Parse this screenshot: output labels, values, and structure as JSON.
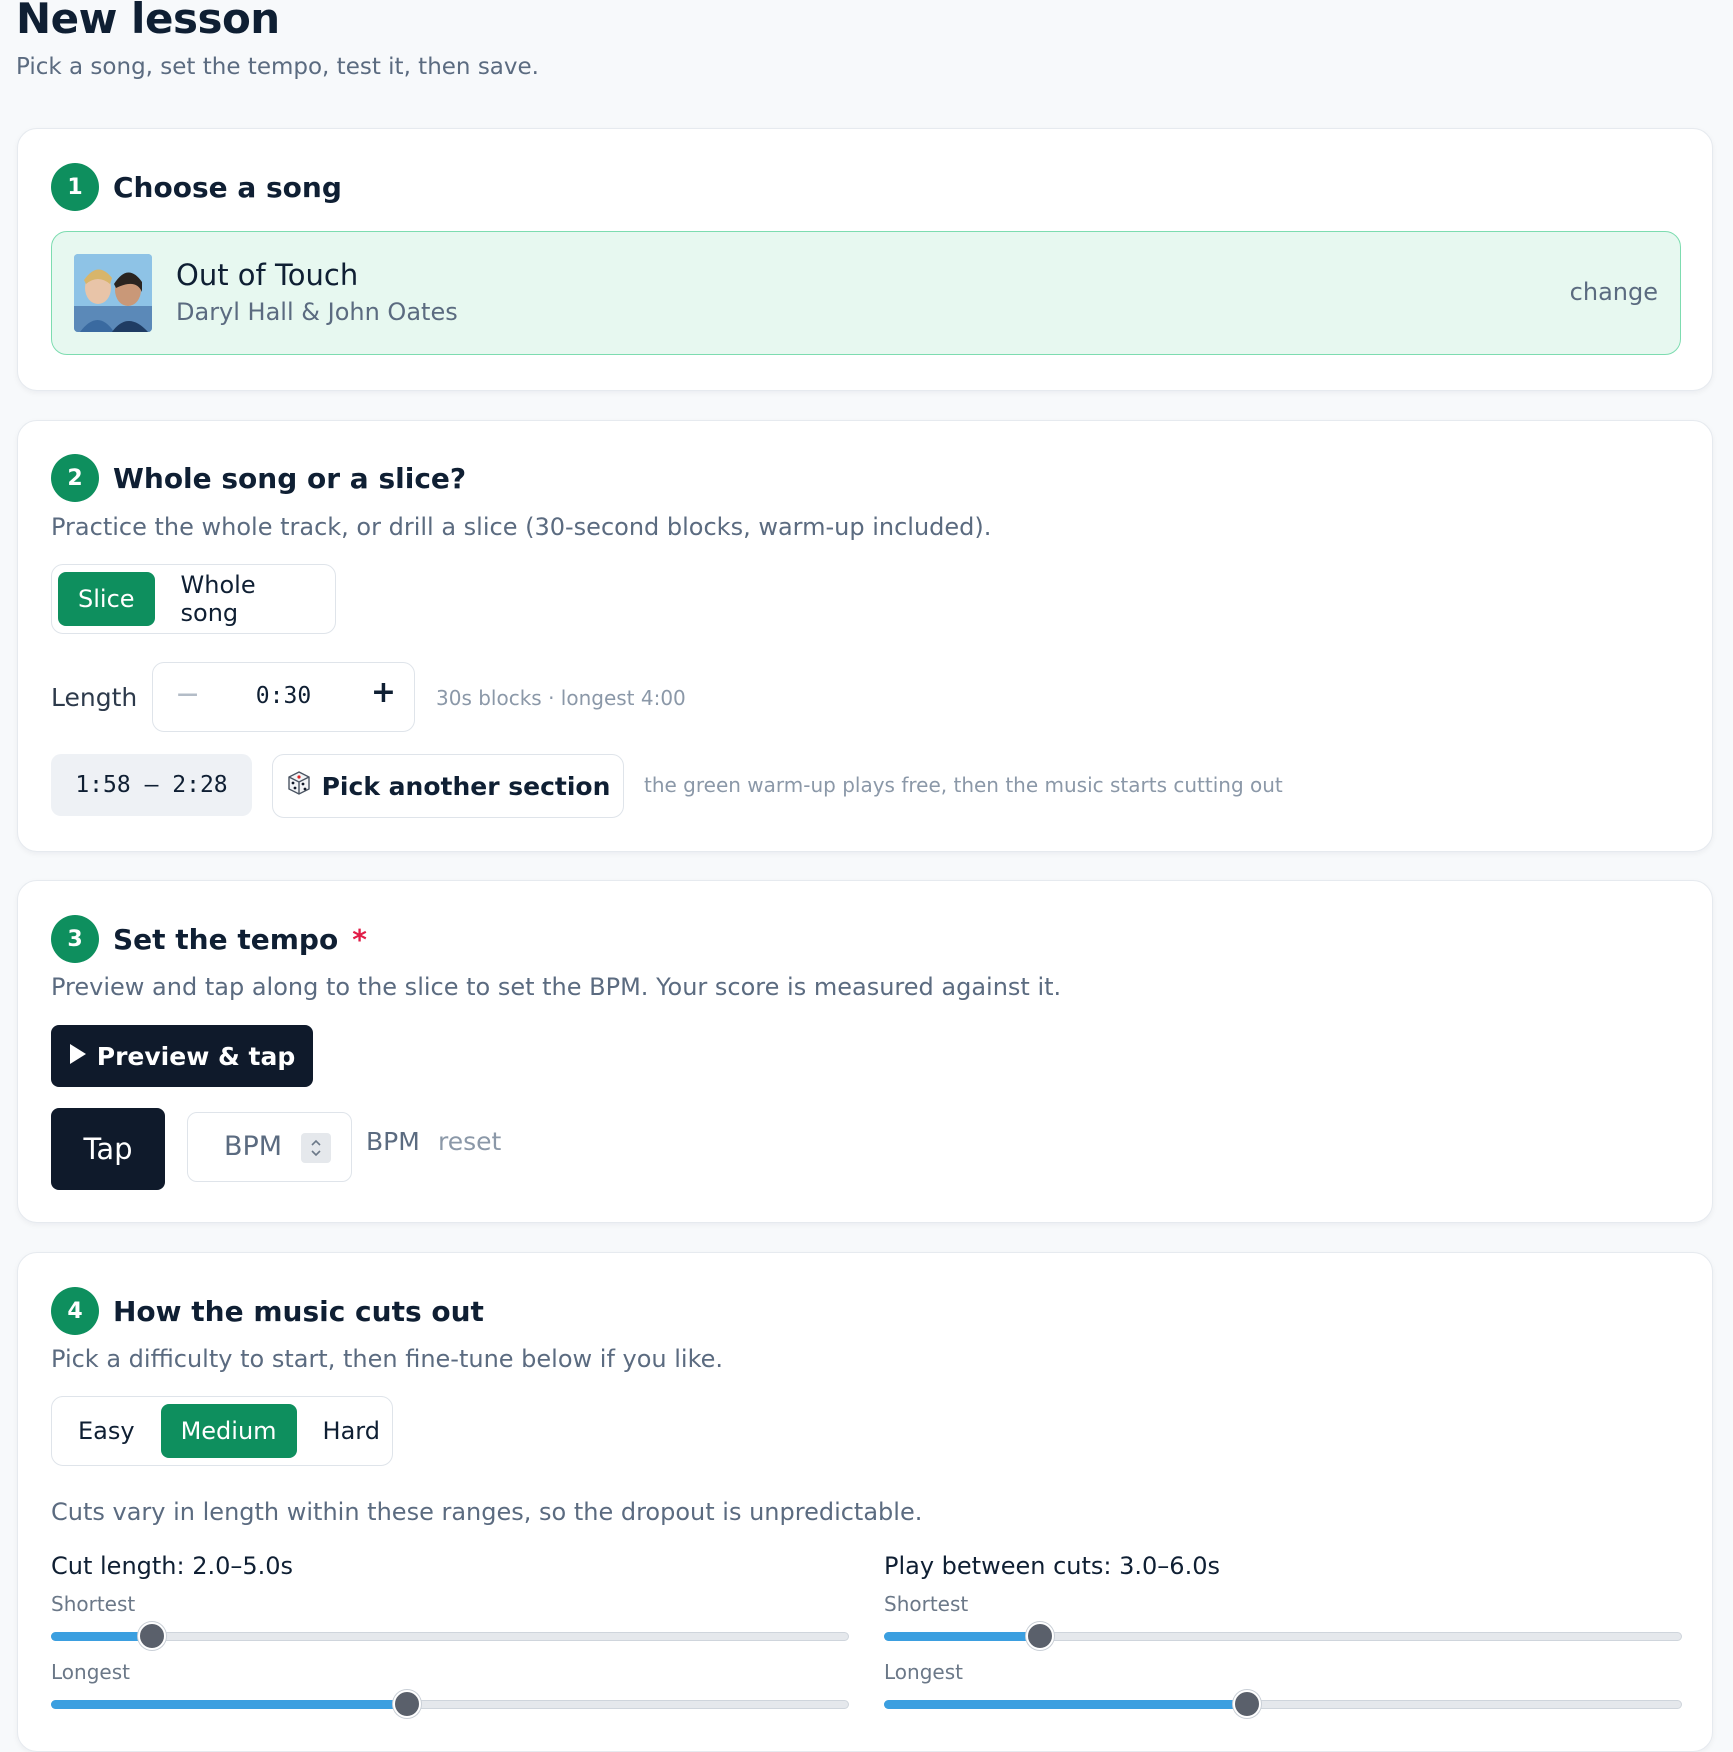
{
  "page": {
    "title": "New lesson",
    "subtitle": "Pick a song, set the tempo, test it, then save."
  },
  "step1": {
    "number": "1",
    "title": "Choose a song",
    "song_title": "Out of Touch",
    "artist": "Daryl Hall & John Oates",
    "change_label": "change"
  },
  "step2": {
    "number": "2",
    "title": "Whole song or a slice?",
    "description": "Practice the whole track, or drill a slice (30-second blocks, warm-up included).",
    "modes": [
      "Slice",
      "Whole song"
    ],
    "selected_mode": "Slice",
    "length_label": "Length",
    "length_minus": "−",
    "length_value": "0:30",
    "length_plus": "+",
    "length_hint": "30s blocks · longest 4:00",
    "range": "1:58 – 2:28",
    "pick_label": "Pick another section",
    "pick_icon": "dice-icon",
    "range_hint": "the green warm-up plays free, then the music starts cutting out"
  },
  "step3": {
    "number": "3",
    "title": "Set the tempo",
    "required_mark": "*",
    "description": "Preview and tap along to the slice to set the BPM. Your score is measured against it.",
    "preview_label": "Preview & tap",
    "tap_label": "Tap",
    "bpm_placeholder": "BPM",
    "bpm_unit": "BPM",
    "reset_label": "reset"
  },
  "step4": {
    "number": "4",
    "title": "How the music cuts out",
    "description": "Pick a difficulty to start, then fine-tune below if you like.",
    "difficulties": [
      "Easy",
      "Medium",
      "Hard"
    ],
    "selected_difficulty": "Medium",
    "note": "Cuts vary in length within these ranges, so the dropout is unpredictable.",
    "cut_length": {
      "title": "Cut length: 2.0–5.0s",
      "shortest_label": "Shortest",
      "longest_label": "Longest",
      "shortest_fraction": 0.127,
      "longest_fraction": 0.446
    },
    "play_between": {
      "title": "Play between cuts: 3.0–6.0s",
      "shortest_label": "Shortest",
      "longest_label": "Longest",
      "shortest_fraction": 0.196,
      "longest_fraction": 0.455
    }
  },
  "colors": {
    "accent": "#0e8f5e",
    "song_bg": "#e7f8f0",
    "dark_button": "#0f1a2b",
    "slider_fill": "#3b9fe0",
    "required": "#e11d48"
  }
}
